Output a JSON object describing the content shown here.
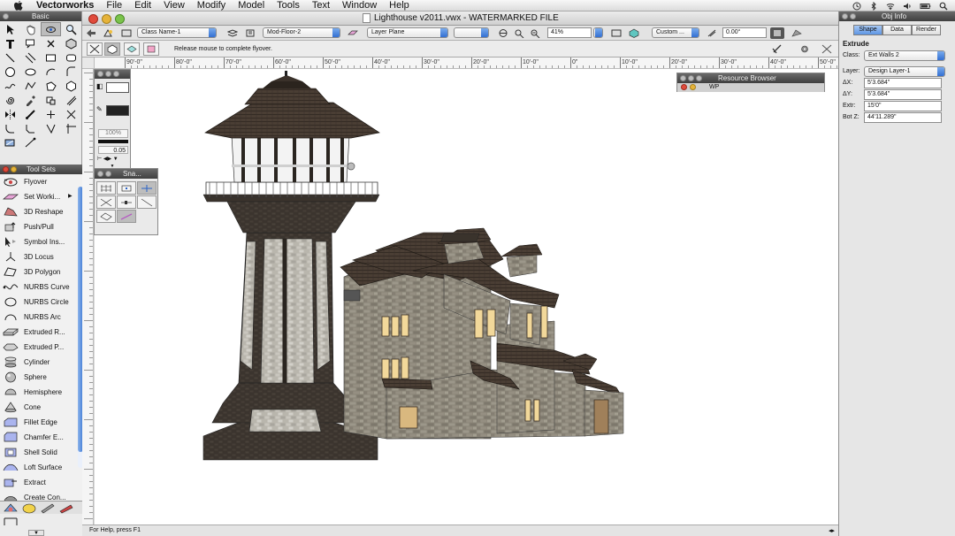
{
  "menubar": {
    "app_name": "Vectorworks",
    "items": [
      "File",
      "Edit",
      "View",
      "Modify",
      "Model",
      "Tools",
      "Text",
      "Window",
      "Help"
    ]
  },
  "basic_palette": {
    "title": "Basic"
  },
  "tool_sets": {
    "title": "Tool Sets",
    "tools": [
      {
        "label": "Flyover",
        "icon": "flyover-icon",
        "selected": true
      },
      {
        "label": "Set Worki...",
        "icon": "set-working-plane-icon",
        "submenu": true
      },
      {
        "label": "3D Reshape",
        "icon": "3d-reshape-icon"
      },
      {
        "label": "Push/Pull",
        "icon": "push-pull-icon"
      },
      {
        "label": "Symbol Ins...",
        "icon": "symbol-insertion-icon"
      },
      {
        "label": "3D Locus",
        "icon": "3d-locus-icon"
      },
      {
        "label": "3D Polygon",
        "icon": "3d-polygon-icon"
      },
      {
        "label": "NURBS Curve",
        "icon": "nurbs-curve-icon"
      },
      {
        "label": "NURBS Circle",
        "icon": "nurbs-circle-icon"
      },
      {
        "label": "NURBS Arc",
        "icon": "nurbs-arc-icon"
      },
      {
        "label": "Extruded R...",
        "icon": "extruded-rectangle-icon"
      },
      {
        "label": "Extruded P...",
        "icon": "extruded-polygon-icon"
      },
      {
        "label": "Cylinder",
        "icon": "cylinder-icon"
      },
      {
        "label": "Sphere",
        "icon": "sphere-icon"
      },
      {
        "label": "Hemisphere",
        "icon": "hemisphere-icon"
      },
      {
        "label": "Cone",
        "icon": "cone-icon"
      },
      {
        "label": "Fillet Edge",
        "icon": "fillet-edge-icon"
      },
      {
        "label": "Chamfer E...",
        "icon": "chamfer-edge-icon"
      },
      {
        "label": "Shell Solid",
        "icon": "shell-solid-icon"
      },
      {
        "label": "Loft Surface",
        "icon": "loft-surface-icon"
      },
      {
        "label": "Extract",
        "icon": "extract-icon"
      },
      {
        "label": "Create Con...",
        "icon": "create-contours-icon"
      }
    ]
  },
  "document": {
    "title": "Lighthouse v2011.vwx - WATERMARKED FILE"
  },
  "viewbar": {
    "class_name": "Class Name-1",
    "floor": "Mod-Floor-2",
    "plane": "Layer Plane",
    "zoom": "41%",
    "view": "Custom ...",
    "angle": "0.00°"
  },
  "modebar": {
    "prompt": "Release mouse to complete flyover."
  },
  "ruler": {
    "labels": [
      "90'-0\"",
      "80'-0\"",
      "70'-0\"",
      "60'-0\"",
      "50'-0\"",
      "40'-0\"",
      "30'-0\"",
      "20'-0\"",
      "10'-0\"",
      "0\"",
      "10'-0\"",
      "20'-0\"",
      "30'-0\"",
      "40'-0\"",
      "50'-0\""
    ]
  },
  "attributes_palette": {
    "opacity": "100%",
    "line_weight": "0.05"
  },
  "snapping_palette": {
    "title": "Sna..."
  },
  "resource_browser": {
    "title": "Resource Browser",
    "item": "WP"
  },
  "obj_info": {
    "title": "Obj Info",
    "tabs": [
      "Shape",
      "Data",
      "Render"
    ],
    "object_type": "Extrude",
    "class_label": "Class:",
    "class_value": "Ext Walls 2",
    "layer_label": "Layer:",
    "layer_value": "Design Layer-1",
    "dx_label": "ΔX:",
    "dx_value": "5'3.684\"",
    "dy_label": "ΔY:",
    "dy_value": "5'3.684\"",
    "extr_label": "Extr:",
    "extr_value": "15'0\"",
    "botz_label": "Bot Z:",
    "botz_value": "44'11.289\""
  },
  "status": {
    "help": "For Help, press F1"
  }
}
